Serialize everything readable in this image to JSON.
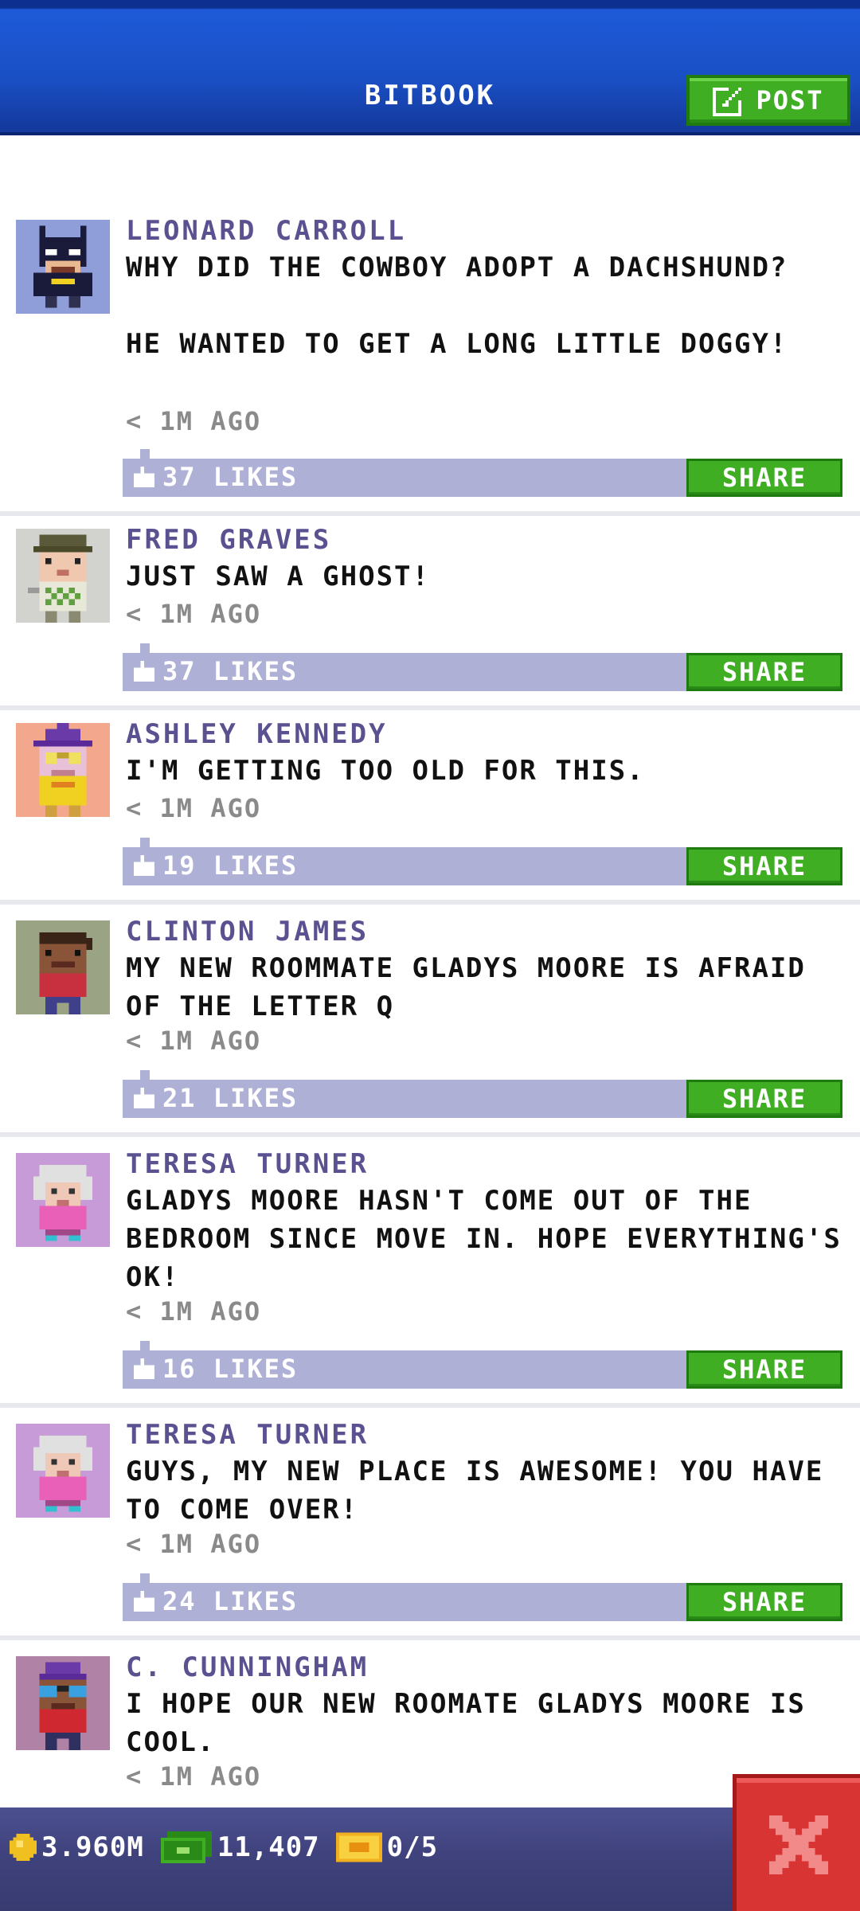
{
  "header": {
    "title": "BITBOOK",
    "post_label": "POST"
  },
  "posts": [
    {
      "name": "LEONARD CARROLL",
      "text": "WHY DID THE COWBOY ADOPT A DACHSHUND?\n\nHE WANTED TO GET A LONG LITTLE DOGGY!",
      "time": "< 1M AGO",
      "likes": "37 LIKES",
      "share": "SHARE",
      "avatar": {
        "bg": "#8f9ed8",
        "icon": "batman-avatar-icon"
      }
    },
    {
      "name": "FRED GRAVES",
      "text": "JUST SAW A GHOST!",
      "time": "< 1M AGO",
      "likes": "37 LIKES",
      "share": "SHARE",
      "avatar": {
        "bg": "#d2d2ce",
        "icon": "golfer-avatar-icon"
      }
    },
    {
      "name": "ASHLEY KENNEDY",
      "text": "I'M GETTING TOO OLD FOR THIS.",
      "time": "< 1M AGO",
      "likes": "19 LIKES",
      "share": "SHARE",
      "avatar": {
        "bg": "#f3a88e",
        "icon": "wizard-avatar-icon"
      }
    },
    {
      "name": "CLINTON JAMES",
      "text": "MY NEW ROOMMATE GLADYS MOORE IS AFRAID OF THE LETTER Q",
      "time": "< 1M AGO",
      "likes": "21 LIKES",
      "share": "SHARE",
      "avatar": {
        "bg": "#9aa484",
        "icon": "person-avatar-icon"
      }
    },
    {
      "name": "TERESA TURNER",
      "text": "GLADYS MOORE HASN'T COME OUT OF THE BEDROOM SINCE MOVE IN. HOPE EVERYTHING'S OK!",
      "time": "< 1M AGO",
      "likes": "16 LIKES",
      "share": "SHARE",
      "avatar": {
        "bg": "#c79ad8",
        "icon": "grandma-avatar-icon"
      }
    },
    {
      "name": "TERESA TURNER",
      "text": "GUYS, MY NEW PLACE IS AWESOME! YOU HAVE TO COME OVER!",
      "time": "< 1M AGO",
      "likes": "24 LIKES",
      "share": "SHARE",
      "avatar": {
        "bg": "#c79ad8",
        "icon": "grandma-avatar-icon"
      }
    },
    {
      "name": "C. CUNNINGHAM",
      "text": "I HOPE OUR NEW ROOMATE GLADYS MOORE IS COOL.",
      "time": "< 1M AGO",
      "likes": "",
      "share": "",
      "avatar": {
        "bg": "#b082a6",
        "icon": "sunglasses-avatar-icon"
      }
    }
  ],
  "bottom": {
    "coins": "3.960M",
    "bux": "11,407",
    "tickets": "0/5"
  },
  "colors": {
    "header_blue": "#1a4fc4",
    "accent_green": "#3fae22",
    "like_bar": "#aeb0d6",
    "name_purple": "#5a5290",
    "close_red": "#d83434"
  }
}
